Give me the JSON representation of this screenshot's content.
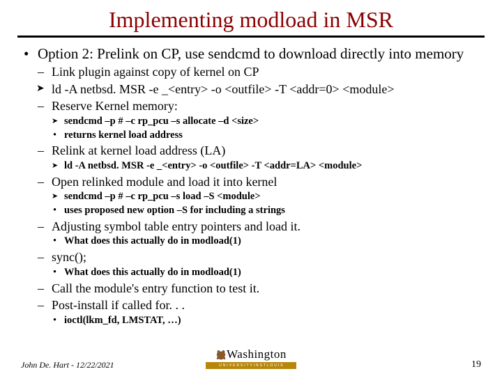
{
  "title": "Implementing modload in MSR",
  "main": {
    "label": "Option 2: Prelink on CP, use sendcmd to download directly into memory",
    "items": [
      {
        "label": "Link plugin against copy of kernel on CP",
        "type": "dash"
      },
      {
        "label": "ld -A netbsd. MSR -e _<entry> -o <outfile> -T <addr=0>  <module>",
        "type": "arrow"
      },
      {
        "label": "Reserve Kernel memory:",
        "type": "dash",
        "sub": [
          {
            "label": "sendcmd –p # –c rp_pcu –s allocate –d <size>",
            "type": "arrow"
          },
          {
            "label": "returns kernel load address",
            "type": "bullet"
          }
        ]
      },
      {
        "label": "Relink at kernel load address (LA)",
        "type": "dash",
        "sub": [
          {
            "label": "ld -A netbsd. MSR -e _<entry> -o <outfile> -T <addr=LA>  <module>",
            "type": "arrow"
          }
        ]
      },
      {
        "label": "Open relinked module and load it into kernel",
        "type": "dash",
        "sub": [
          {
            "label": "sendcmd –p # –c rp_pcu –s load –S <module>",
            "type": "arrow"
          },
          {
            "label": "uses proposed new option –S for including a strings",
            "type": "bullet"
          }
        ]
      },
      {
        "label": "Adjusting symbol table entry pointers and load it.",
        "type": "dash",
        "sub": [
          {
            "label": "What does this actually do in modload(1)",
            "type": "bullet"
          }
        ]
      },
      {
        "label": "sync();",
        "type": "dash",
        "sub": [
          {
            "label": "What does this actually do in modload(1)",
            "type": "bullet"
          }
        ]
      },
      {
        "label": "Call the module's entry function to test it.",
        "type": "dash"
      },
      {
        "label": "Post-install if called for. . .",
        "type": "dash",
        "sub": [
          {
            "label": "ioctl(lkm_fd, LMSTAT, …)",
            "type": "bullet"
          }
        ]
      }
    ]
  },
  "footer": {
    "author": "John De. Hart - 12/22/2021"
  },
  "page": "19",
  "washington": {
    "label": "Washington",
    "sub": "U N I V E R S I T Y  I N  S T  L O U I S"
  }
}
